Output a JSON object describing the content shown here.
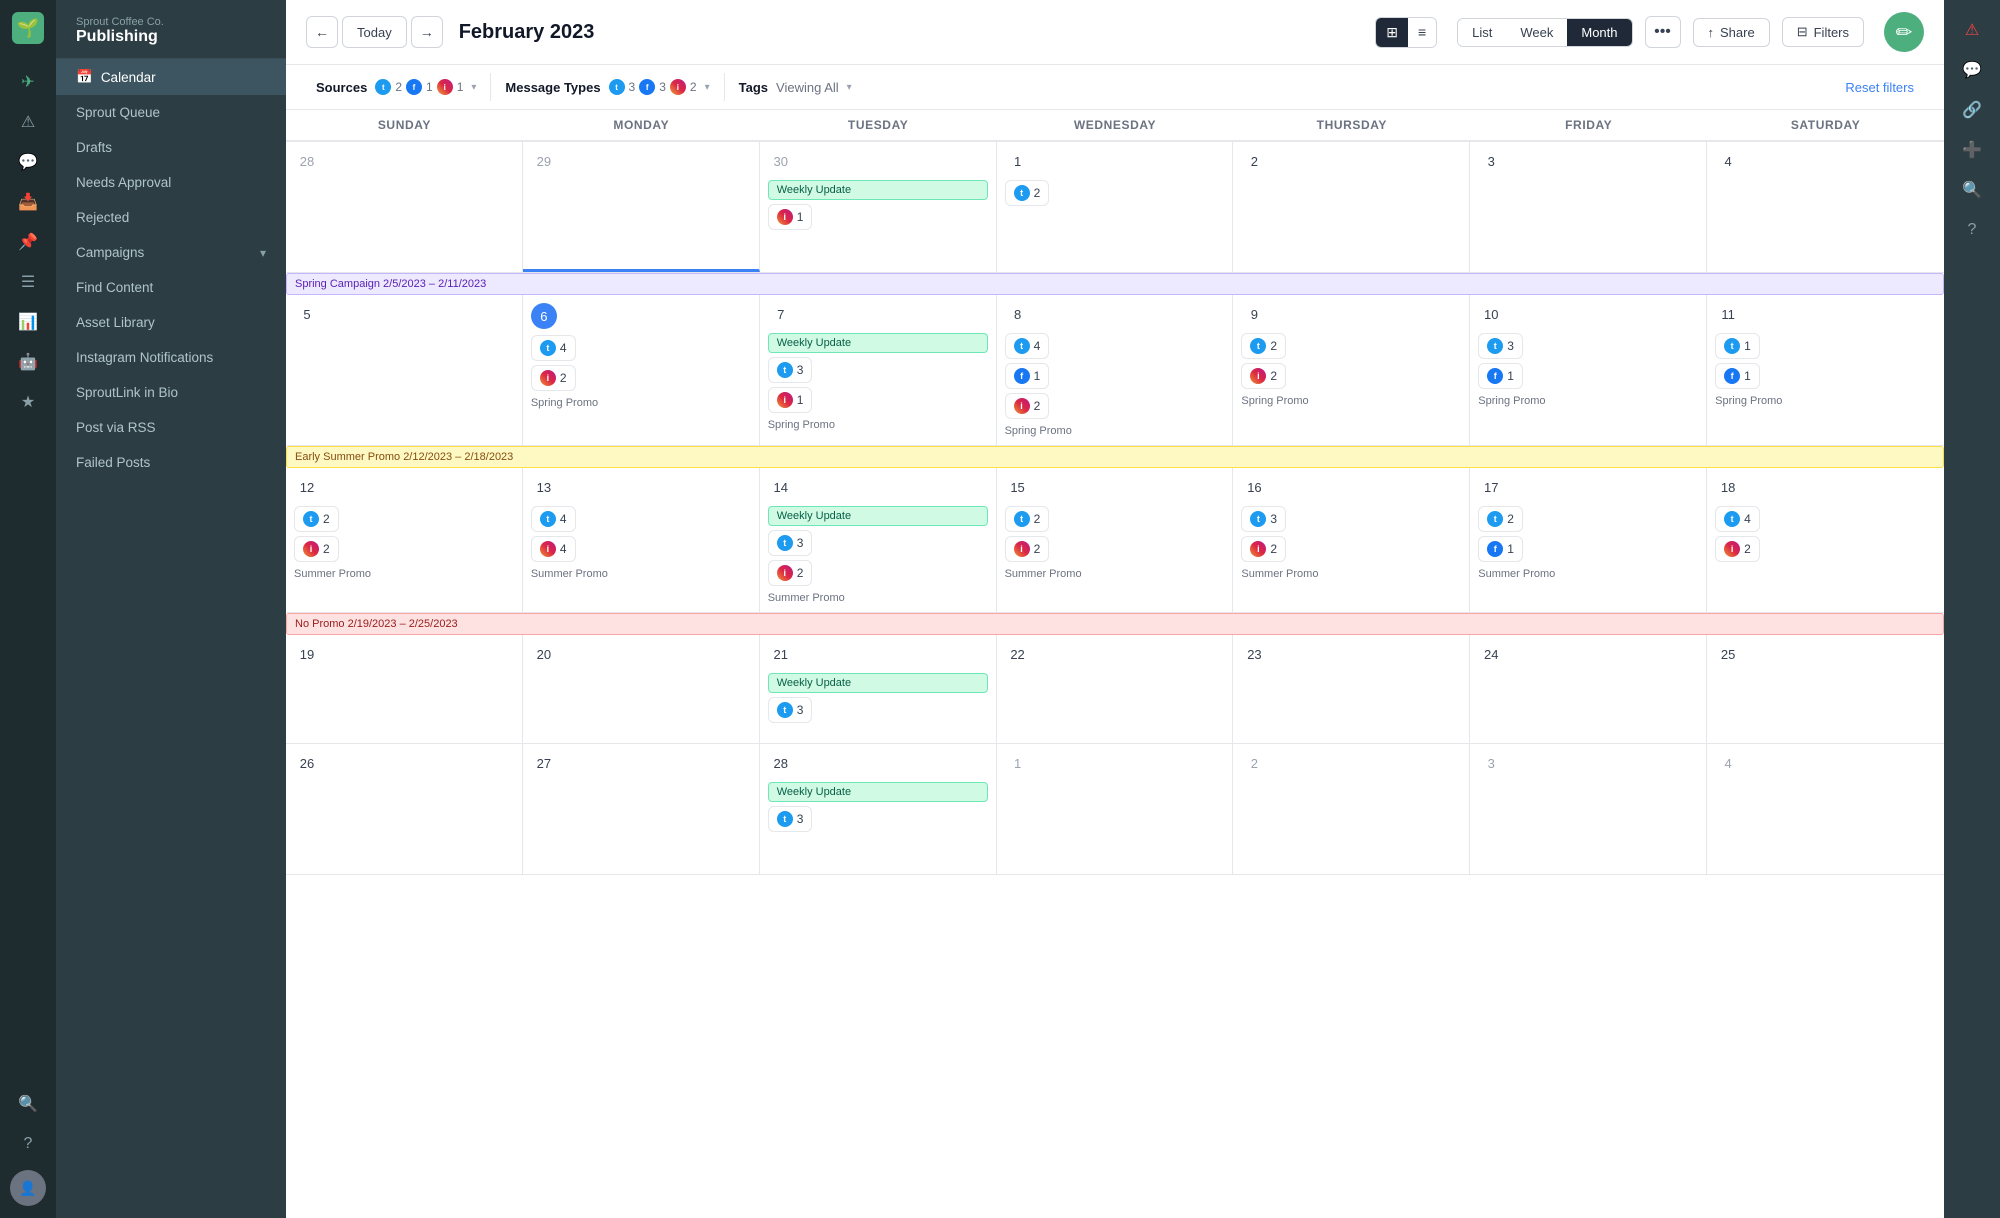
{
  "app": {
    "company": "Sprout Coffee Co.",
    "product": "Publishing"
  },
  "sidebar": {
    "items": [
      {
        "id": "calendar",
        "label": "Calendar",
        "active": true
      },
      {
        "id": "sprout-queue",
        "label": "Sprout Queue"
      },
      {
        "id": "drafts",
        "label": "Drafts"
      },
      {
        "id": "needs-approval",
        "label": "Needs Approval"
      },
      {
        "id": "rejected",
        "label": "Rejected"
      },
      {
        "id": "campaigns",
        "label": "Campaigns",
        "hasChevron": true
      },
      {
        "id": "find-content",
        "label": "Find Content"
      },
      {
        "id": "asset-library",
        "label": "Asset Library"
      },
      {
        "id": "instagram-notifications",
        "label": "Instagram Notifications"
      },
      {
        "id": "sproutlink",
        "label": "SproutLink in Bio"
      },
      {
        "id": "post-via-rss",
        "label": "Post via RSS"
      },
      {
        "id": "failed-posts",
        "label": "Failed Posts"
      }
    ]
  },
  "header": {
    "title": "February 2023",
    "today_label": "Today",
    "view_modes": [
      "List",
      "Week",
      "Month"
    ],
    "active_view": "Month",
    "share_label": "Share",
    "filters_label": "Filters"
  },
  "filters": {
    "sources_label": "Sources",
    "sources_counts": {
      "twitter": 2,
      "facebook": 1,
      "instagram": 1
    },
    "message_types_label": "Message Types",
    "message_types_counts": {
      "twitter": 3,
      "facebook": 3,
      "instagram": 2
    },
    "tags_label": "Tags",
    "tags_value": "Viewing All",
    "reset_label": "Reset filters"
  },
  "calendar": {
    "day_headers": [
      "Sunday",
      "Monday",
      "Tuesday",
      "Wednesday",
      "Thursday",
      "Friday",
      "Saturday"
    ],
    "weeks": [
      {
        "id": "week1",
        "banner": null,
        "days": [
          {
            "date": "28",
            "other_month": true,
            "cells": []
          },
          {
            "date": "29",
            "other_month": true,
            "cells": []
          },
          {
            "date": "30",
            "other_month": true,
            "cells": [
              {
                "type": "event",
                "label": "Weekly Update",
                "color": "green"
              },
              {
                "type": "social",
                "icon": "instagram",
                "count": 1
              }
            ]
          },
          {
            "date": "1",
            "cells": [
              {
                "type": "social",
                "icon": "twitter",
                "count": 2
              }
            ]
          },
          {
            "date": "2",
            "cells": []
          },
          {
            "date": "3",
            "cells": []
          },
          {
            "date": "4",
            "cells": []
          }
        ]
      },
      {
        "id": "week2",
        "banner": {
          "label": "Spring Campaign 2/5/2023 – 2/11/2023",
          "color": "purple"
        },
        "days": [
          {
            "date": "5",
            "cells": []
          },
          {
            "date": "6",
            "today": true,
            "cells": [
              {
                "type": "social",
                "icon": "twitter",
                "count": 4
              },
              {
                "type": "social",
                "icon": "instagram",
                "count": 2
              },
              {
                "type": "promo",
                "label": "Spring Promo"
              }
            ]
          },
          {
            "date": "7",
            "cells": [
              {
                "type": "event",
                "label": "Weekly Update",
                "color": "green"
              },
              {
                "type": "social",
                "icon": "twitter",
                "count": 3
              },
              {
                "type": "social",
                "icon": "instagram",
                "count": 1
              },
              {
                "type": "promo",
                "label": "Spring Promo"
              }
            ]
          },
          {
            "date": "8",
            "cells": [
              {
                "type": "social",
                "icon": "twitter",
                "count": 4
              },
              {
                "type": "social",
                "icon": "facebook",
                "count": 1
              },
              {
                "type": "social",
                "icon": "instagram",
                "count": 2
              },
              {
                "type": "promo",
                "label": "Spring Promo"
              }
            ]
          },
          {
            "date": "9",
            "cells": [
              {
                "type": "social",
                "icon": "twitter",
                "count": 2
              },
              {
                "type": "social",
                "icon": "instagram",
                "count": 2
              },
              {
                "type": "promo",
                "label": "Spring Promo"
              }
            ]
          },
          {
            "date": "10",
            "cells": [
              {
                "type": "social",
                "icon": "twitter",
                "count": 3
              },
              {
                "type": "social",
                "icon": "facebook",
                "count": 1
              },
              {
                "type": "promo",
                "label": "Spring Promo"
              }
            ]
          },
          {
            "date": "11",
            "cells": [
              {
                "type": "social",
                "icon": "twitter",
                "count": 1
              },
              {
                "type": "social",
                "icon": "facebook",
                "count": 1
              },
              {
                "type": "promo",
                "label": "Spring Promo"
              }
            ]
          }
        ]
      },
      {
        "id": "week3",
        "banner": {
          "label": "Early Summer Promo 2/12/2023 – 2/18/2023",
          "color": "yellow"
        },
        "days": [
          {
            "date": "12",
            "cells": [
              {
                "type": "social",
                "icon": "twitter",
                "count": 2
              },
              {
                "type": "social",
                "icon": "instagram",
                "count": 2
              },
              {
                "type": "promo",
                "label": "Summer Promo"
              }
            ]
          },
          {
            "date": "13",
            "cells": [
              {
                "type": "social",
                "icon": "twitter",
                "count": 4
              },
              {
                "type": "social",
                "icon": "instagram",
                "count": 4
              },
              {
                "type": "promo",
                "label": "Summer Promo"
              }
            ]
          },
          {
            "date": "14",
            "cells": [
              {
                "type": "event",
                "label": "Weekly Update",
                "color": "green"
              },
              {
                "type": "social",
                "icon": "twitter",
                "count": 3
              },
              {
                "type": "social",
                "icon": "instagram",
                "count": 2
              },
              {
                "type": "promo",
                "label": "Summer Promo"
              }
            ]
          },
          {
            "date": "15",
            "cells": [
              {
                "type": "social",
                "icon": "twitter",
                "count": 2
              },
              {
                "type": "social",
                "icon": "instagram",
                "count": 2
              },
              {
                "type": "promo",
                "label": "Summer Promo"
              }
            ]
          },
          {
            "date": "16",
            "cells": [
              {
                "type": "social",
                "icon": "twitter",
                "count": 3
              },
              {
                "type": "social",
                "icon": "instagram",
                "count": 2
              },
              {
                "type": "promo",
                "label": "Summer Promo"
              }
            ]
          },
          {
            "date": "17",
            "cells": [
              {
                "type": "social",
                "icon": "twitter",
                "count": 2
              },
              {
                "type": "social",
                "icon": "facebook",
                "count": 1
              },
              {
                "type": "promo",
                "label": "Summer Promo"
              }
            ]
          },
          {
            "date": "18",
            "cells": [
              {
                "type": "social",
                "icon": "twitter",
                "count": 4
              },
              {
                "type": "social",
                "icon": "instagram",
                "count": 2
              }
            ]
          }
        ]
      },
      {
        "id": "week4",
        "banner": {
          "label": "No Promo 2/19/2023 – 2/25/2023",
          "color": "peach"
        },
        "days": [
          {
            "date": "19",
            "cells": []
          },
          {
            "date": "20",
            "cells": []
          },
          {
            "date": "21",
            "cells": [
              {
                "type": "event",
                "label": "Weekly Update",
                "color": "green"
              },
              {
                "type": "social",
                "icon": "twitter",
                "count": 3
              }
            ]
          },
          {
            "date": "22",
            "cells": []
          },
          {
            "date": "23",
            "cells": []
          },
          {
            "date": "24",
            "cells": []
          },
          {
            "date": "25",
            "cells": []
          }
        ]
      },
      {
        "id": "week5",
        "banner": null,
        "days": [
          {
            "date": "26",
            "cells": []
          },
          {
            "date": "27",
            "cells": []
          },
          {
            "date": "28",
            "cells": [
              {
                "type": "event",
                "label": "Weekly Update",
                "color": "green"
              }
            ]
          },
          {
            "date": "1",
            "other_month": true,
            "cells": []
          },
          {
            "date": "2",
            "other_month": true,
            "cells": []
          },
          {
            "date": "3",
            "other_month": true,
            "cells": []
          },
          {
            "date": "4",
            "other_month": true,
            "cells": []
          }
        ]
      }
    ]
  },
  "icons": {
    "back_arrow": "←",
    "forward_arrow": "→",
    "grid_view": "⊞",
    "list_view": "≡",
    "more": "•••",
    "share": "↑",
    "filter": "⊟",
    "compose": "+",
    "alert": "⚠",
    "speech": "💬",
    "link": "🔗",
    "plus": "+",
    "search": "🔍",
    "question": "?"
  }
}
